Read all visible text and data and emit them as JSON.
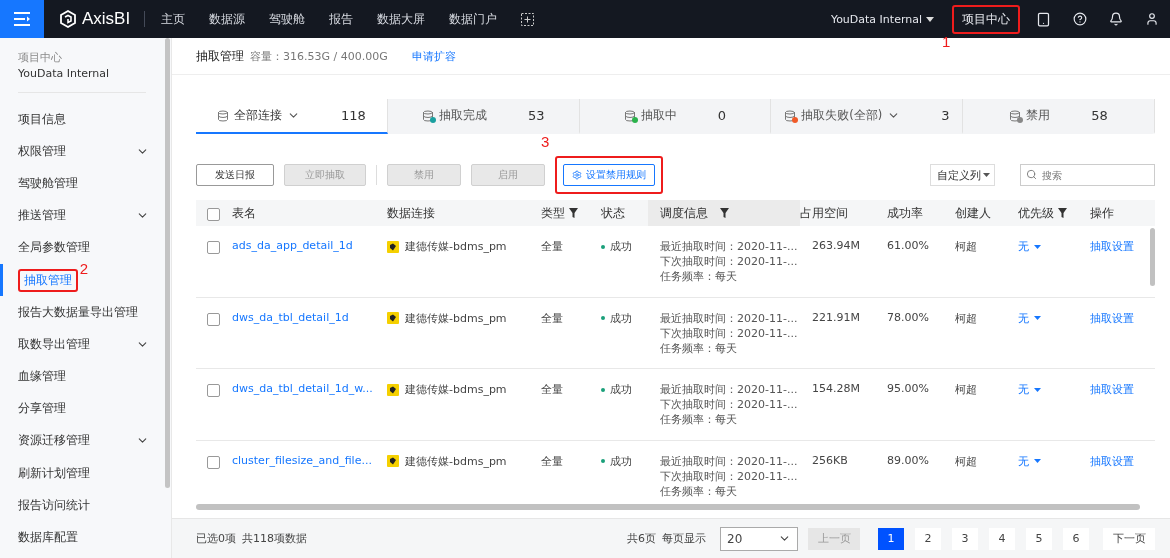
{
  "top_bar": {
    "logo": "AxisBI",
    "nav": [
      {
        "label": "主页"
      },
      {
        "label": "数据源"
      },
      {
        "label": "驾驶舱"
      },
      {
        "label": "报告"
      },
      {
        "label": "数据大屏"
      },
      {
        "label": "数据门户"
      }
    ],
    "workspace": "YouData Internal",
    "project_center": {
      "label": "项目中心",
      "annotation": "1"
    }
  },
  "sidebar": {
    "caption": "项目中心",
    "project": "YouData Internal",
    "items": [
      {
        "label": "项目信息",
        "expandable": false,
        "selected": false
      },
      {
        "label": "权限管理",
        "expandable": true,
        "selected": false
      },
      {
        "label": "驾驶舱管理",
        "expandable": false,
        "selected": false
      },
      {
        "label": "推送管理",
        "expandable": true,
        "selected": false
      },
      {
        "label": "全局参数管理",
        "expandable": false,
        "selected": false
      },
      {
        "label": "抽取管理",
        "expandable": false,
        "selected": true,
        "annotation": "2"
      },
      {
        "label": "报告大数据量导出管理",
        "expandable": false,
        "selected": false
      },
      {
        "label": "取数导出管理",
        "expandable": true,
        "selected": false
      },
      {
        "label": "血缘管理",
        "expandable": false,
        "selected": false
      },
      {
        "label": "分享管理",
        "expandable": false,
        "selected": false
      },
      {
        "label": "资源迁移管理",
        "expandable": true,
        "selected": false
      },
      {
        "label": "刷新计划管理",
        "expandable": false,
        "selected": false
      },
      {
        "label": "报告访问统计",
        "expandable": false,
        "selected": false
      },
      {
        "label": "数据库配置",
        "expandable": false,
        "selected": false
      }
    ]
  },
  "header": {
    "title": "抽取管理",
    "capacity": "容量：316.53G / 400.00G",
    "link": "申请扩容"
  },
  "stats": [
    {
      "kind": "all",
      "label": "全部连接",
      "count": "118",
      "dropdown": true,
      "selected": true
    },
    {
      "kind": "done",
      "label": "抽取完成",
      "count": "53",
      "dropdown": false,
      "selected": false
    },
    {
      "kind": "running",
      "label": "抽取中",
      "count": "0",
      "dropdown": false,
      "selected": false
    },
    {
      "kind": "failed",
      "label": "抽取失败(全部)",
      "count": "3",
      "dropdown": true,
      "selected": false
    },
    {
      "kind": "disabled",
      "label": "禁用",
      "count": "58",
      "dropdown": false,
      "selected": false
    }
  ],
  "toolbar": {
    "buttons": [
      {
        "kind": "plain",
        "label": "发送日报",
        "disabled": false
      },
      {
        "kind": "plain",
        "label": "立即抽取",
        "disabled": true
      },
      {
        "kind": "separator"
      },
      {
        "kind": "plain",
        "label": "禁用",
        "disabled": true
      },
      {
        "kind": "plain",
        "label": "启用",
        "disabled": true
      },
      {
        "kind": "rule",
        "label": "设置禁用规则",
        "disabled": false,
        "annotation": "3"
      }
    ],
    "custom_columns": "自定义列",
    "search_placeholder": "搜索"
  },
  "table": {
    "select_all_checked": false,
    "columns": [
      {
        "label": "表名",
        "filter": false
      },
      {
        "label": "数据连接",
        "filter": false
      },
      {
        "label": "类型",
        "filter": true
      },
      {
        "label": "状态",
        "filter": false
      },
      {
        "label": "调度信息",
        "filter": true
      },
      {
        "label": "占用空间",
        "filter": false
      },
      {
        "label": "成功率",
        "filter": false
      },
      {
        "label": "创建人",
        "filter": false
      },
      {
        "label": "优先级",
        "filter": true
      },
      {
        "label": "操作",
        "filter": false
      }
    ],
    "rows": [
      {
        "checked": false,
        "name": "ads_da_app_detail_1d",
        "connection": "建德传媒-bdms_pm",
        "type": "全量",
        "status": "成功",
        "schedule": [
          "最近抽取时间：2020-11-...",
          "下次抽取时间：2020-11-...",
          "任务频率：每天"
        ],
        "size": "263.94M",
        "rate": "61.00%",
        "creator": "柯超",
        "priority": "无",
        "action": "抽取设置"
      },
      {
        "checked": false,
        "name": "dws_da_tbl_detail_1d",
        "connection": "建德传媒-bdms_pm",
        "type": "全量",
        "status": "成功",
        "schedule": [
          "最近抽取时间：2020-11-...",
          "下次抽取时间：2020-11-...",
          "任务频率：每天"
        ],
        "size": "221.91M",
        "rate": "78.00%",
        "creator": "柯超",
        "priority": "无",
        "action": "抽取设置"
      },
      {
        "checked": false,
        "name": "dws_da_tbl_detail_1d_w...",
        "connection": "建德传媒-bdms_pm",
        "type": "全量",
        "status": "成功",
        "schedule": [
          "最近抽取时间：2020-11-...",
          "下次抽取时间：2020-11-...",
          "任务频率：每天"
        ],
        "size": "154.28M",
        "rate": "95.00%",
        "creator": "柯超",
        "priority": "无",
        "action": "抽取设置"
      },
      {
        "checked": false,
        "name": "cluster_filesize_and_file...",
        "connection": "建德传媒-bdms_pm",
        "type": "全量",
        "status": "成功",
        "schedule": [
          "最近抽取时间：2020-11-...",
          "下次抽取时间：2020-11-...",
          "任务频率：每天"
        ],
        "size": "256KB",
        "rate": "89.00%",
        "creator": "柯超",
        "priority": "无",
        "action": "抽取设置"
      }
    ]
  },
  "footer": {
    "selected": "已选0项",
    "total": "共118项数据",
    "pages_total": "共6页",
    "page_size_label": "每页显示",
    "page_size": "20",
    "prev": {
      "label": "上一页",
      "disabled": true
    },
    "pages": [
      {
        "label": "1",
        "selected": true
      },
      {
        "label": "2",
        "selected": false
      },
      {
        "label": "3",
        "selected": false
      },
      {
        "label": "4",
        "selected": false
      },
      {
        "label": "5",
        "selected": false
      },
      {
        "label": "6",
        "selected": false
      }
    ],
    "next": {
      "label": "下一页",
      "disabled": false
    }
  }
}
